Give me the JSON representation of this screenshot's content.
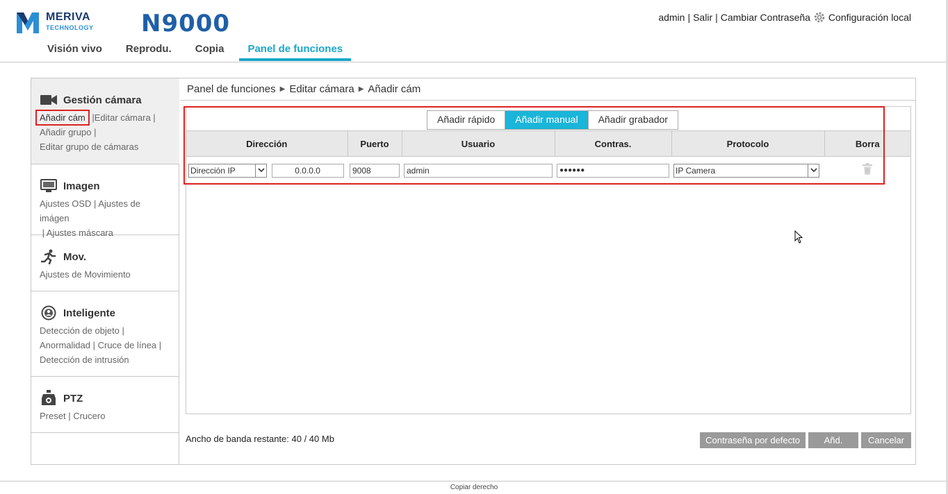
{
  "header": {
    "logo_name": "MERIVA",
    "logo_sub": "TECHNOLOGY",
    "model": "N9000",
    "user": "admin",
    "logout": "Salir",
    "change_password": "Cambiar Contraseña",
    "local_config": "Configuración local",
    "nav": [
      "Visión vivo",
      "Reprodu.",
      "Copia",
      "Panel de funciones"
    ]
  },
  "sidebar": {
    "camera": {
      "title": "Gestión cámara",
      "links": [
        "Añadir cám",
        "Editar cámara",
        "Añadir grupo",
        "Editar grupo de cámaras"
      ]
    },
    "image": {
      "title": "Imagen",
      "links": [
        "Ajustes OSD",
        "Ajustes de imágen",
        "Ajustes máscara"
      ]
    },
    "motion": {
      "title": "Mov.",
      "links": [
        "Ajustes de Movimiento"
      ]
    },
    "smart": {
      "title": "Inteligente",
      "links": [
        "Detección de objeto",
        "Anormalidad",
        "Cruce de línea",
        "Detección de intrusión"
      ]
    },
    "ptz": {
      "title": "PTZ",
      "links": [
        "Preset",
        "Crucero"
      ]
    }
  },
  "breadcrumb": [
    "Panel de funciones",
    "Editar cámara",
    "Añadir cám"
  ],
  "tabs": [
    "Añadir rápido",
    "Añadir manual",
    "Añadir grabador"
  ],
  "table": {
    "headers": [
      "Dirección",
      "Puerto",
      "Usuario",
      "Contras.",
      "Protocolo",
      "Borra"
    ],
    "row": {
      "address_type": "Dirección IP",
      "ip": "0.0.0.0",
      "port": "9008",
      "user": "admin",
      "password": "●●●●●●",
      "protocol": "IP Camera"
    }
  },
  "bandwidth": "Ancho de banda restante: 40 / 40 Mb",
  "buttons": {
    "default_password": "Contraseña por defecto",
    "add": "Añd.",
    "cancel": "Cancelar"
  },
  "footer": "Copiar derecho",
  "colors": {
    "accent": "#1ab5d9",
    "brand": "#1f5fa8",
    "highlight": "#dd2222"
  }
}
